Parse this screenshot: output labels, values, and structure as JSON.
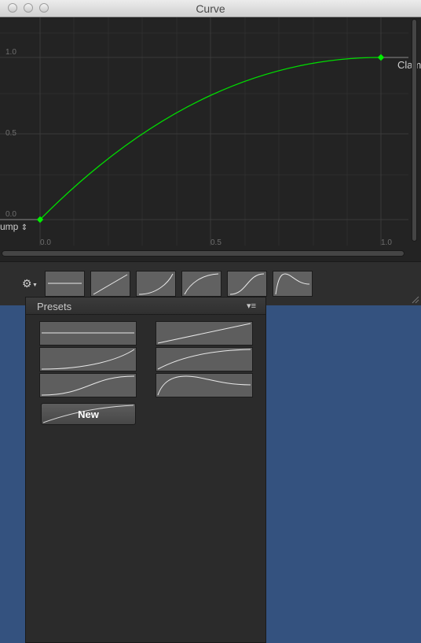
{
  "window": {
    "title": "Curve"
  },
  "graph": {
    "y_ticks": [
      "1.0",
      "0.5",
      "0.0"
    ],
    "x_ticks": [
      "0.0",
      "0.5",
      "1.0"
    ],
    "pre_wrap_label": "ump",
    "post_wrap_label": "Clam",
    "curve_color": "#00dd00",
    "keyframes": [
      {
        "time": 0.0,
        "value": 0.0
      },
      {
        "time": 1.0,
        "value": 1.0
      }
    ]
  },
  "toolbar": {
    "settings_icon": "gear-icon"
  },
  "presets": {
    "title": "Presets",
    "menu_icon": "menu-icon",
    "new_label": "New"
  }
}
